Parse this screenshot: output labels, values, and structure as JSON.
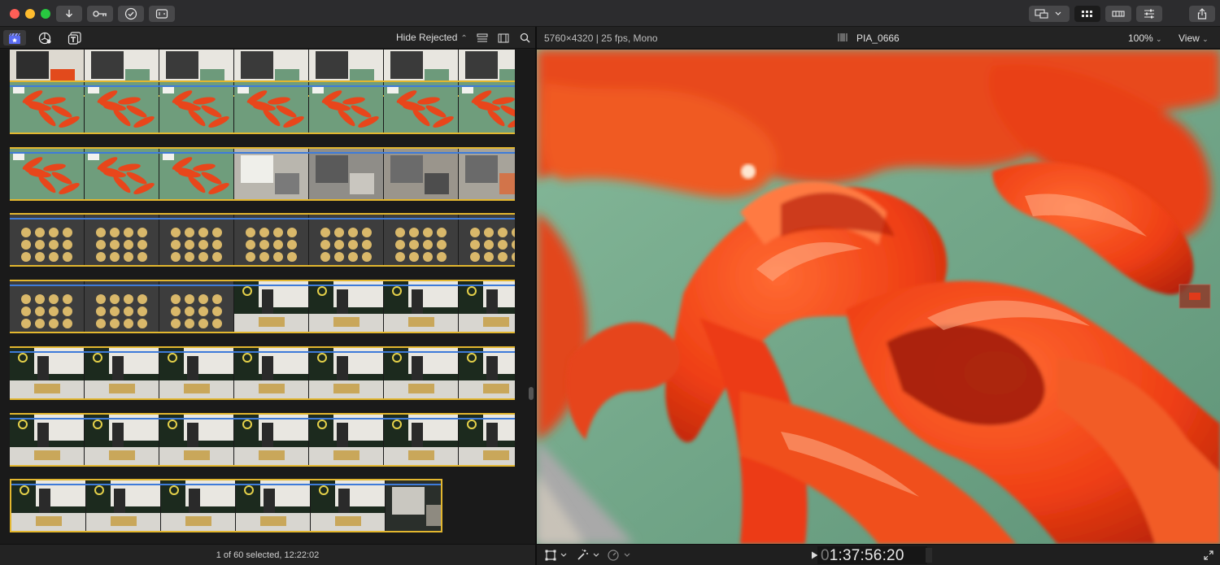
{
  "browser": {
    "filter_label": "Hide Rejected",
    "status": "1 of 60 selected, 12:22:02"
  },
  "viewer": {
    "clip_info": "5760×4320 | 25 fps, Mono",
    "clip_name": "PIA_0666",
    "zoom": "100%",
    "view_menu": "View",
    "timecode_dim": "0",
    "timecode": "1:37:56:20"
  },
  "icons": {
    "toolbar": [
      "import-icon",
      "keyword-icon",
      "background-tasks-icon",
      "library-properties-icon"
    ],
    "right_toolbar": [
      "window-layout-icon",
      "browser-icon",
      "timeline-icon",
      "inspector-icon",
      "share-icon"
    ],
    "browser_tabs": [
      "libraries-icon",
      "photos-audio-icon",
      "titles-generators-icon"
    ]
  },
  "colors": {
    "accent_blue": "#3e7bd9",
    "selection_yellow": "#e3b72f",
    "window_bg": "#1e1e1e"
  }
}
